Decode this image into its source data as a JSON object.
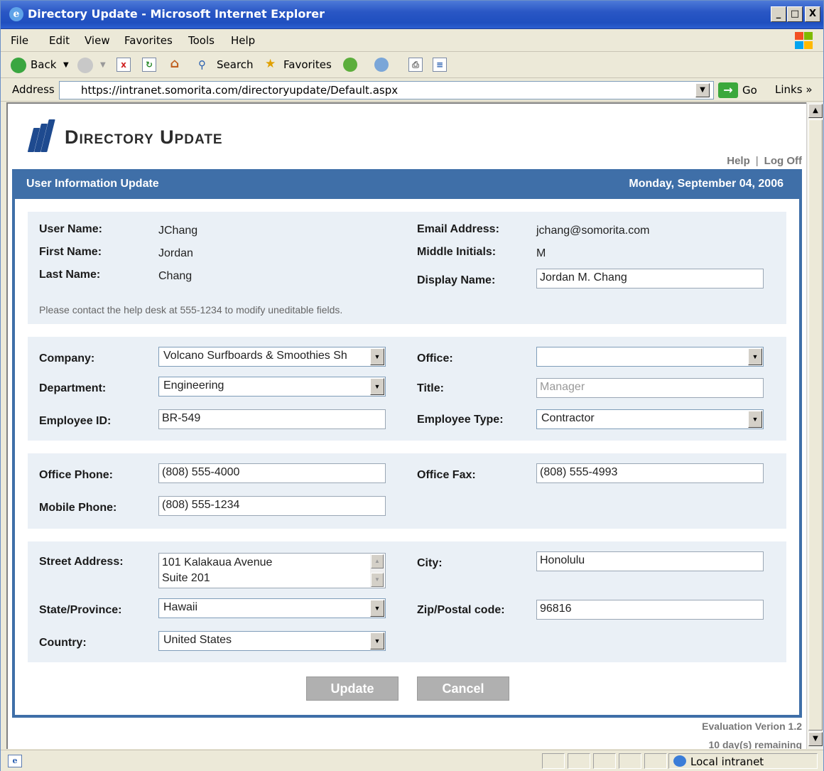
{
  "window": {
    "title": "Directory Update - Microsoft Internet Explorer",
    "minimize": "_",
    "maximize": "□",
    "close": "X"
  },
  "menu": [
    "File",
    "Edit",
    "View",
    "Favorites",
    "Tools",
    "Help"
  ],
  "toolbar": {
    "back": "Back",
    "search": "Search",
    "favorites": "Favorites"
  },
  "address": {
    "label": "Address",
    "url": "https://intranet.somorita.com/directoryupdate/Default.aspx",
    "go": "Go",
    "links": "Links"
  },
  "page": {
    "app_title": "Directory Update",
    "links": {
      "help": "Help",
      "separator": "|",
      "logoff": "Log Off"
    },
    "header": {
      "title": "User Information Update",
      "date": "Monday, September 04, 2006"
    },
    "identity": {
      "user_name_label": "User Name:",
      "user_name": "JChang",
      "first_name_label": "First Name:",
      "first_name": "Jordan",
      "last_name_label": "Last Name:",
      "last_name": "Chang",
      "email_label": "Email Address:",
      "email": "jchang@somorita.com",
      "middle_label": "Middle Initials:",
      "middle": "M",
      "display_label": "Display Name:",
      "display_name": "Jordan M. Chang",
      "note": "Please contact the help desk at 555-1234 to modify uneditable fields."
    },
    "org": {
      "company_label": "Company:",
      "company": "Volcano Surfboards & Smoothies Sh",
      "department_label": "Department:",
      "department": "Engineering",
      "employee_id_label": "Employee ID:",
      "employee_id": "BR-549",
      "office_label": "Office:",
      "office": "",
      "title_label": "Title:",
      "title": "Manager",
      "employee_type_label": "Employee Type:",
      "employee_type": "Contractor"
    },
    "phone": {
      "office_phone_label": "Office Phone:",
      "office_phone": "(808) 555-4000",
      "mobile_phone_label": "Mobile Phone:",
      "mobile_phone": "(808) 555-1234",
      "office_fax_label": "Office Fax:",
      "office_fax": "(808) 555-4993"
    },
    "address": {
      "street_label": "Street Address:",
      "street_line1": "101 Kalakaua Avenue",
      "street_line2": "Suite 201",
      "state_label": "State/Province:",
      "state": "Hawaii",
      "country_label": "Country:",
      "country": "United States",
      "city_label": "City:",
      "city": "Honolulu",
      "zip_label": "Zip/Postal code:",
      "zip": "96816"
    },
    "buttons": {
      "update": "Update",
      "cancel": "Cancel"
    },
    "footer": {
      "version": "Evaluation Verion 1.2",
      "remaining": "10 day(s) remaining"
    }
  },
  "status": {
    "zone": "Local intranet"
  },
  "colors": {
    "header_blue": "#3f6fa8",
    "panel_bg": "#eaf0f6",
    "title_bar": "#2a57c5"
  }
}
